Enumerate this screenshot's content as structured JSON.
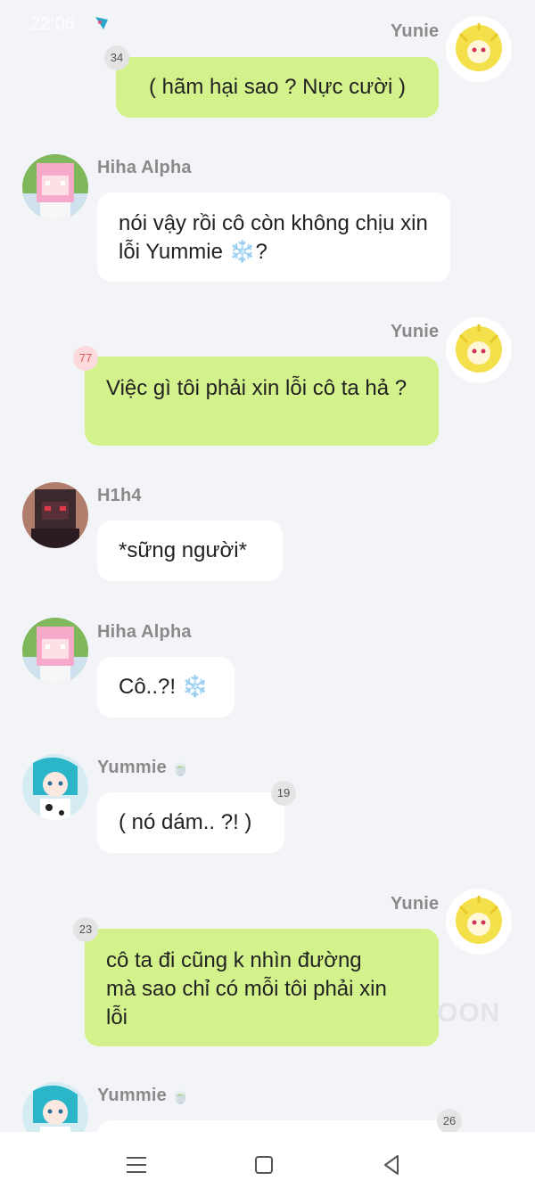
{
  "status": {
    "time": "22:06"
  },
  "watermark": "OON",
  "messages": [
    {
      "sender": "Yunie",
      "text": "( hãm hại sao ? Nực cười )",
      "badge": "34"
    },
    {
      "sender": "Hiha Alpha",
      "text": "nói vậy rồi cô còn không chịu xin lỗi Yummie ❄️?"
    },
    {
      "sender": "Yunie",
      "text": "Việc gì tôi phải xin lỗi cô ta hả ?",
      "badge": "77"
    },
    {
      "sender": "H1h4",
      "text": "*sững người*"
    },
    {
      "sender": "Hiha Alpha",
      "text": "Cô..?! ❄️"
    },
    {
      "sender": "Yummie",
      "sender_icon": "🍵",
      "text": "( nó dám.. ?! )",
      "badge": "19"
    },
    {
      "sender": "Yunie",
      "text": "cô ta đi cũng k nhìn đường mà sao chỉ có mỗi tôi phải xin lỗi",
      "badge": "23"
    },
    {
      "sender": "Yummie",
      "sender_icon": "🍵",
      "text": "",
      "badge": "26"
    }
  ],
  "nav": {
    "menu_icon": "menu-icon",
    "home_icon": "home-icon",
    "back_icon": "back-icon"
  },
  "colors": {
    "background": "#f3f4f8",
    "outgoing_bubble": "#d4f28b",
    "incoming_bubble": "#ffffff"
  }
}
